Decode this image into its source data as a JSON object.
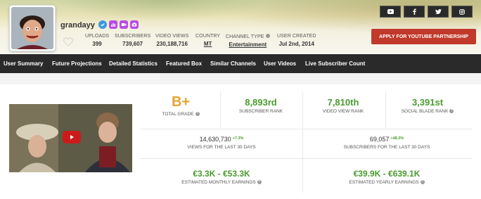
{
  "channel": {
    "username": "grandayy",
    "badges": [
      "verified-icon",
      "bar-chart-icon",
      "video-icon",
      "camera-icon"
    ]
  },
  "header_stats": [
    {
      "key": "uploads",
      "label": "UPLOADS",
      "value": "399"
    },
    {
      "key": "subscribers",
      "label": "SUBSCRIBERS",
      "value": "739,607"
    },
    {
      "key": "views",
      "label": "VIDEO VIEWS",
      "value": "230,188,716"
    },
    {
      "key": "country",
      "label": "COUNTRY",
      "value": "MT"
    },
    {
      "key": "type",
      "label": "CHANNEL TYPE",
      "value": "Entertainment"
    },
    {
      "key": "created",
      "label": "USER CREATED",
      "value": "Jul 2nd, 2014"
    }
  ],
  "partner_button": "APPLY FOR YOUTUBE PARTNERSHIP",
  "social_icons": [
    "youtube-icon",
    "facebook-icon",
    "twitter-icon",
    "instagram-icon"
  ],
  "nav": [
    "User Summary",
    "Future Projections",
    "Detailed Statistics",
    "Featured Box",
    "Similar Channels",
    "User Videos",
    "Live Subscriber Count"
  ],
  "ranks": {
    "grade": {
      "value": "B+",
      "label": "TOTAL GRADE"
    },
    "subscriber_rank": {
      "value": "8,893rd",
      "label": "SUBSCRIBER RANK"
    },
    "view_rank": {
      "value": "7,810th",
      "label": "VIDEO VIEW RANK"
    },
    "sb_rank": {
      "value": "3,391st",
      "label": "SOCIAL BLADE RANK"
    }
  },
  "thirty_day": {
    "views": {
      "value": "14,630,730",
      "change": "+7.3%",
      "label": "VIEWS FOR THE LAST 30 DAYS"
    },
    "subs": {
      "value": "69,057",
      "change": "+48.2%",
      "label": "SUBSCRIBERS FOR THE LAST 30 DAYS"
    }
  },
  "earnings": {
    "monthly": {
      "value": "€3.3K - €53.3K",
      "label": "ESTIMATED MONTHLY EARNINGS"
    },
    "yearly": {
      "value": "€39.9K - €639.1K",
      "label": "ESTIMATED YEARLY EARNINGS"
    }
  },
  "colors": {
    "accent_green": "#4a9a2e",
    "grade_orange": "#e7a431",
    "partner_red": "#c0392b",
    "nav_bg": "#2a2a2a"
  }
}
